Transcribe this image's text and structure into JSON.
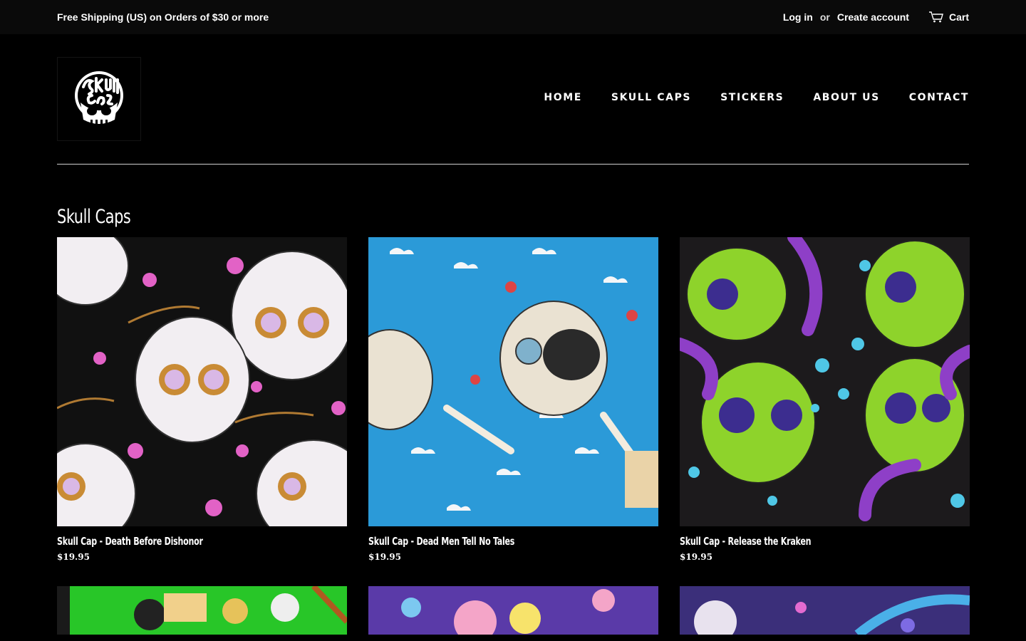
{
  "topbar": {
    "announcement": "Free Shipping (US) on Orders of $30 or more",
    "login": "Log in",
    "or": "or",
    "create_account": "Create account",
    "cart": "Cart"
  },
  "logo": {
    "text": "Skull Caps"
  },
  "nav": {
    "items": [
      {
        "label": "HOME"
      },
      {
        "label": "SKULL CAPS"
      },
      {
        "label": "STICKERS"
      },
      {
        "label": "ABOUT US"
      },
      {
        "label": "CONTACT"
      }
    ]
  },
  "collection": {
    "title": "Skull Caps",
    "products": [
      {
        "name": "Skull Cap - Death Before Dishonor",
        "price": "$19.95"
      },
      {
        "name": "Skull Cap - Dead Men Tell No Tales",
        "price": "$19.95"
      },
      {
        "name": "Skull Cap - Release the Kraken",
        "price": "$19.95"
      }
    ]
  },
  "colors": {
    "background": "#000000",
    "topbar": "#0a0a0a",
    "text": "#ffffff",
    "divider": "#cfcfcf"
  },
  "icons": {
    "cart": "cart-icon"
  }
}
